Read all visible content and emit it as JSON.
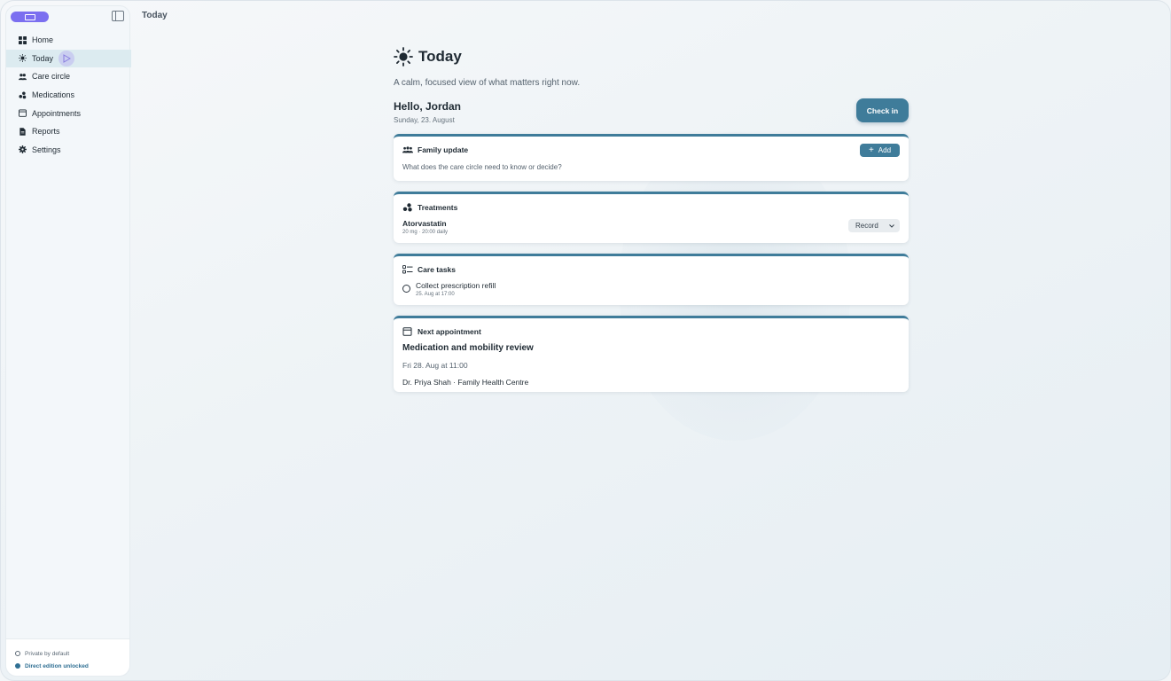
{
  "topbar": {
    "title": "Today"
  },
  "sidebar": {
    "items": [
      {
        "label": "Home",
        "icon": "grid-icon"
      },
      {
        "label": "Today",
        "icon": "sun-icon",
        "active": true
      },
      {
        "label": "Care circle",
        "icon": "people-icon"
      },
      {
        "label": "Medications",
        "icon": "pills-icon"
      },
      {
        "label": "Appointments",
        "icon": "calendar-icon"
      },
      {
        "label": "Reports",
        "icon": "document-icon"
      },
      {
        "label": "Settings",
        "icon": "gear-icon"
      }
    ],
    "footer": {
      "privacy": "Private by default",
      "edition": "Direct edition unlocked"
    }
  },
  "main": {
    "title": "Today",
    "subtitle": "A calm, focused view of what matters right now.",
    "greeting": "Hello, Jordan",
    "date": "Sunday, 23. August",
    "check_in_label": "Check in",
    "family_update": {
      "title": "Family update",
      "add_label": "Add",
      "prompt": "What does the care circle need to know or decide?"
    },
    "treatments": {
      "title": "Treatments",
      "medication": "Atorvastatin",
      "dose": "20 mg · 20:00 daily",
      "record_label": "Record"
    },
    "care_tasks": {
      "title": "Care tasks",
      "tasks": [
        {
          "name": "Collect prescription refill",
          "due": "25. Aug at 17:00"
        }
      ]
    },
    "next_appointment": {
      "title": "Next appointment",
      "name": "Medication and mobility review",
      "when": "Fri 28. Aug at 11:00",
      "who": "Dr. Priya Shah · Family Health Centre"
    }
  },
  "colors": {
    "accent": "#3f7c9a",
    "brand": "#7b6ff0",
    "active_nav": "#dcebf0"
  }
}
